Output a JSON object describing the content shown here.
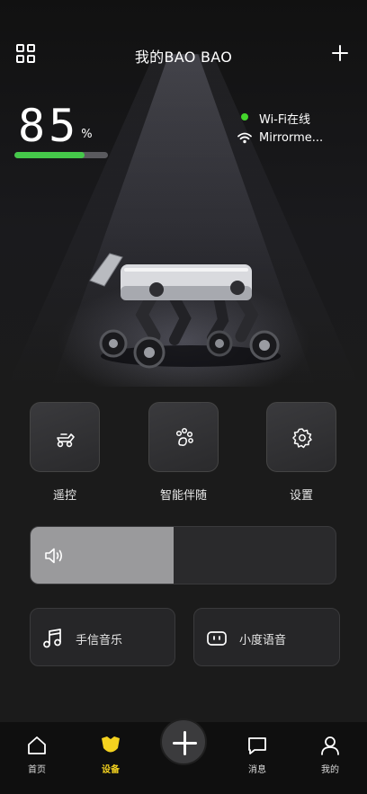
{
  "header": {
    "title": "我的BAO BAO"
  },
  "battery": {
    "value": "85",
    "unit": "%",
    "level": 0.75,
    "color": "#45c84a"
  },
  "status": {
    "wifi_status": "Wi-Fi在线",
    "wifi_status_color": "#44d62c",
    "network_name": "Mirrorme..."
  },
  "actions": [
    {
      "label": "遥控",
      "icon": "remote-control-icon"
    },
    {
      "label": "智能伴随",
      "icon": "paw-icon"
    },
    {
      "label": "设置",
      "icon": "gear-icon"
    }
  ],
  "volume": {
    "icon": "speaker-icon",
    "level": 0.47
  },
  "cards": [
    {
      "label": "手信音乐",
      "icon": "music-note-icon"
    },
    {
      "label": "小度语音",
      "icon": "voice-assistant-icon"
    }
  ],
  "tabbar": {
    "items": [
      {
        "label": "首页",
        "icon": "home-icon",
        "active": false
      },
      {
        "label": "设备",
        "icon": "device-icon",
        "active": true
      },
      {
        "label": "消息",
        "icon": "message-icon",
        "active": false
      },
      {
        "label": "我的",
        "icon": "profile-icon",
        "active": false
      }
    ],
    "center_button": "plus-icon",
    "accent": "#f4d21f"
  }
}
